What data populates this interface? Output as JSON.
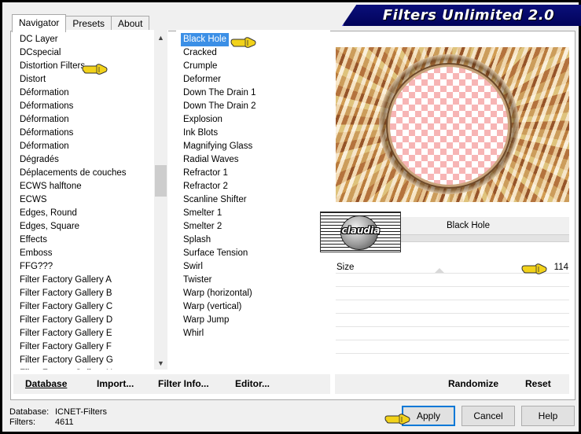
{
  "window": {
    "title": "Filters Unlimited 2.0"
  },
  "tabs": [
    {
      "label": "Navigator",
      "active": true
    },
    {
      "label": "Presets",
      "active": false
    },
    {
      "label": "About",
      "active": false
    }
  ],
  "categories": [
    "DC Layer",
    "DCspecial",
    "Distortion Filters",
    "Distort",
    "Déformation",
    "Déformations",
    "Déformation",
    "Déformations",
    "Déformation",
    "Dégradés",
    "Déplacements de couches",
    "ECWS halftone",
    "ECWS",
    "Edges, Round",
    "Edges, Square",
    "Effects",
    "Emboss",
    "FFG???",
    "Filter Factory Gallery A",
    "Filter Factory Gallery B",
    "Filter Factory Gallery C",
    "Filter Factory Gallery D",
    "Filter Factory Gallery E",
    "Filter Factory Gallery F",
    "Filter Factory Gallery G",
    "Filter Factory Gallery H"
  ],
  "filters": [
    "Black Hole",
    "Cracked",
    "Crumple",
    "Deformer",
    "Down The Drain 1",
    "Down The Drain 2",
    "Explosion",
    "Ink Blots",
    "Magnifying Glass",
    "Radial Waves",
    "Refractor 1",
    "Refractor 2",
    "Scanline Shifter",
    "Smelter 1",
    "Smelter 2",
    "Splash",
    "Surface Tension",
    "Swirl",
    "Twister",
    "Warp (horizontal)",
    "Warp (vertical)",
    "Warp Jump",
    "Whirl"
  ],
  "selected_filter": "Black Hole",
  "parameters": {
    "filter_name": "Black Hole",
    "size_label": "Size",
    "size_value": "114"
  },
  "watermark_text": "claudia",
  "toolbar": {
    "database": "Database",
    "import": "Import...",
    "filter_info": "Filter Info...",
    "editor": "Editor...",
    "randomize": "Randomize",
    "reset": "Reset"
  },
  "status": {
    "database_label": "Database:",
    "database_value": "ICNET-Filters",
    "filters_label": "Filters:",
    "filters_value": "4611"
  },
  "buttons": {
    "apply": "Apply",
    "cancel": "Cancel",
    "help": "Help"
  },
  "colors": {
    "selection": "#3b8fe6",
    "title_banner": "#0a0f7a",
    "pointer_hand": "#f2d21a"
  }
}
